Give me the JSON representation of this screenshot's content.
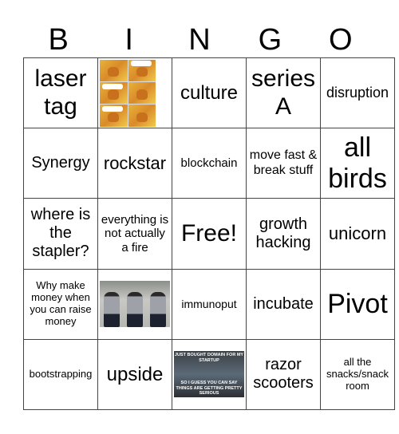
{
  "header": {
    "letters": [
      "B",
      "I",
      "N",
      "G",
      "O"
    ]
  },
  "board": {
    "rows": [
      [
        {
          "text": "laser tag"
        },
        {
          "image": "this-is-fine-dog-comic",
          "alt": "This is fine comic"
        },
        {
          "text": "culture"
        },
        {
          "text": "series A"
        },
        {
          "text": "disruption"
        }
      ],
      [
        {
          "text": "Synergy"
        },
        {
          "text": "rockstar"
        },
        {
          "text": "blockchain"
        },
        {
          "text": "move fast & break stuff"
        },
        {
          "text": "all birds"
        }
      ],
      [
        {
          "text": "where is the stapler?"
        },
        {
          "text": "everything is not actually a fire"
        },
        {
          "text": "Free!"
        },
        {
          "text": "growth hacking"
        },
        {
          "text": "unicorn"
        }
      ],
      [
        {
          "text": "Why make money when you can raise money"
        },
        {
          "image": "men-in-vests-walking-photo",
          "alt": "Men in vests walking"
        },
        {
          "text": "immunoput"
        },
        {
          "text": "incubate"
        },
        {
          "text": "Pivot"
        }
      ],
      [
        {
          "text": "bootstrapping"
        },
        {
          "text": "upside"
        },
        {
          "image": "startup-domain-meme",
          "alt": "Startup domain meme",
          "caption_top": "JUST BOUGHT DOMAIN FOR MY STARTUP",
          "caption_bottom": "SO I GUESS YOU CAN SAY THINGS ARE GETTING PRETTY SERIOUS"
        },
        {
          "text": "razor scooters"
        },
        {
          "text": "all the snacks/snack room"
        }
      ]
    ]
  }
}
